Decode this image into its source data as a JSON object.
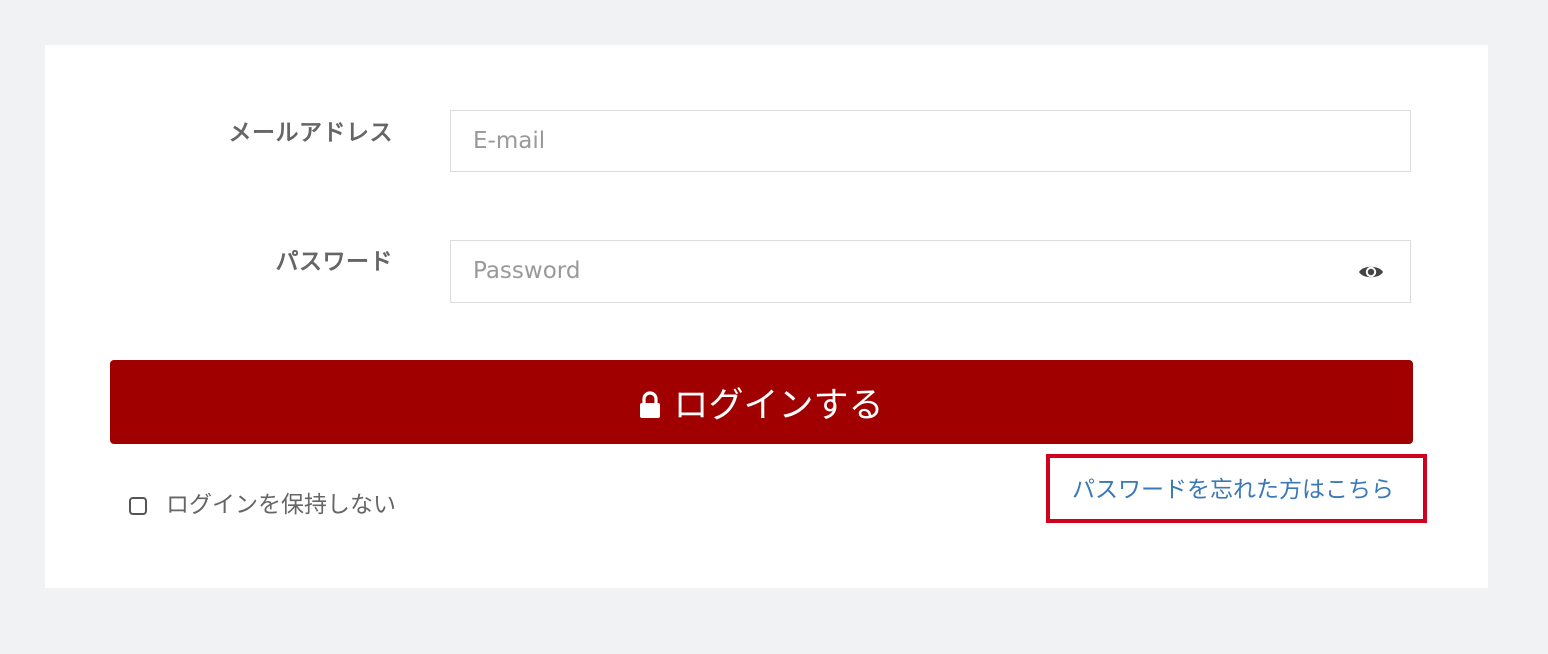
{
  "form": {
    "email_label": "メールアドレス",
    "email_placeholder": "E-mail",
    "password_label": "パスワード",
    "password_placeholder": "Password",
    "password_toggle_icon": "eye-icon"
  },
  "login_button": {
    "icon": "lock-icon",
    "label": "ログインする"
  },
  "remember": {
    "label": "ログインを保持しない",
    "checked": false
  },
  "forgot_password": {
    "label": "パスワードを忘れた方はこちら",
    "highlighted": true
  },
  "colors": {
    "page_background": "#f1f2f4",
    "panel_background": "#ffffff",
    "button": "#a00000",
    "link": "#3a78b6",
    "highlight_border": "#d1001f"
  }
}
